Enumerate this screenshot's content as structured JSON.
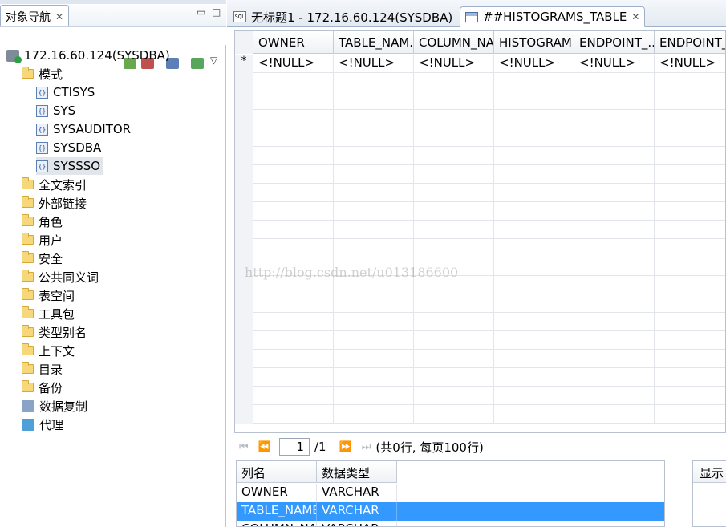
{
  "navigator": {
    "tab_title": "对象导航",
    "tree": {
      "server": "172.16.60.124(SYSDBA)",
      "schema_folder": "模式",
      "schemas": [
        "CTISYS",
        "SYS",
        "SYSAUDITOR",
        "SYSDBA",
        "SYSSSO"
      ],
      "selected_schema": "SYSSSO",
      "folders": [
        "全文索引",
        "外部链接",
        "角色",
        "用户",
        "安全",
        "公共同义词",
        "表空间",
        "工具包",
        "类型别名",
        "上下文",
        "目录",
        "备份"
      ],
      "replication": "数据复制",
      "agent": "代理"
    }
  },
  "editor": {
    "tabs": [
      {
        "label": "无标题1 - 172.16.60.124(SYSDBA)",
        "icon": "sql-icon",
        "active": false
      },
      {
        "label": "##HISTOGRAMS_TABLE",
        "icon": "table-icon",
        "active": true
      }
    ],
    "grid": {
      "columns": [
        "OWNER",
        "TABLE_NAM...",
        "COLUMN_NA",
        "HISTOGRAM",
        "ENDPOINT_...",
        "ENDPOINT_"
      ],
      "new_row_marker": "*",
      "rows": [
        [
          "<!NULL>",
          "<!NULL>",
          "<!NULL>",
          "<!NULL>",
          "<!NULL>",
          "<!NULL>"
        ]
      ]
    },
    "pager": {
      "page": "1",
      "total": "/1",
      "summary": "(共0行, 每页100行)"
    },
    "column_panel": {
      "headers": [
        "列名",
        "数据类型"
      ],
      "rows": [
        {
          "name": "OWNER",
          "type": "VARCHAR"
        },
        {
          "name": "TABLE_NAME",
          "type": "VARCHAR"
        },
        {
          "name": "COLUMN_NA",
          "type": "VARCHAR"
        }
      ],
      "selected_index": 1
    },
    "side_panel_title": "显示"
  },
  "watermark": "http://blog.csdn.net/u013186600",
  "colors": {
    "selection": "#3399ff",
    "folder": "#f6d77a"
  }
}
